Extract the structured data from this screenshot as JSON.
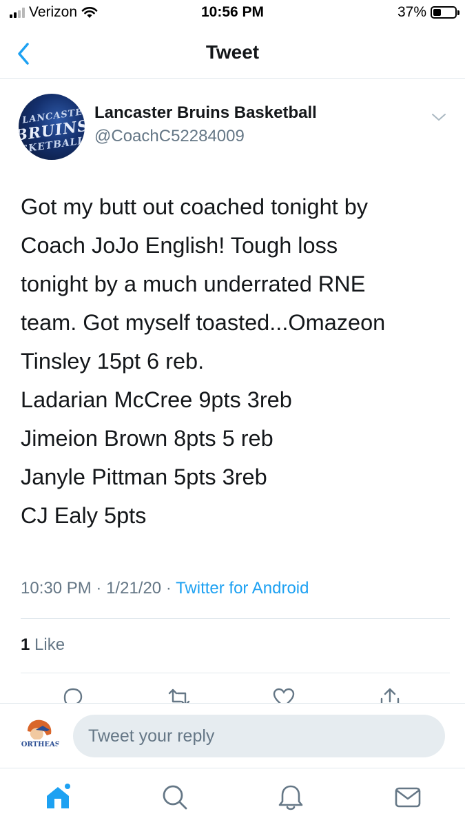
{
  "status_bar": {
    "carrier": "Verizon",
    "time": "10:56 PM",
    "battery": "37%",
    "icons": [
      "signal-icon",
      "wifi-icon",
      "battery-icon"
    ]
  },
  "nav": {
    "title": "Tweet",
    "back_icon": "chevron-left-icon"
  },
  "tweet": {
    "author_name": "Lancaster Bruins Basketball",
    "author_handle": "@CoachC52284009",
    "avatar_text": [
      "LANCASTER",
      "BRUINS",
      "SKETBALL"
    ],
    "lines": [
      "Got my butt out coached tonight by",
      "Coach JoJo English! Tough loss",
      "tonight by a much underrated RNE",
      "team. Got myself toasted...Omazeon",
      "Tinsley 15pt 6 reb.",
      "Ladarian McCree 9pts 3reb",
      "Jimeion Brown 8pts 5 reb",
      "Janyle Pittman 5pts 3reb",
      "CJ Ealy 5pts"
    ],
    "time": "10:30 PM",
    "date": "1/21/20",
    "separator": "·",
    "source": "Twitter for Android",
    "like_count": "1",
    "like_label": "Like"
  },
  "actions": [
    "reply-icon",
    "retweet-icon",
    "like-icon",
    "share-icon"
  ],
  "reply_bar": {
    "placeholder": "Tweet your reply",
    "avatar_text": "NORTHEAST"
  },
  "tabs": [
    "home-icon",
    "search-icon",
    "notifications-icon",
    "messages-icon"
  ],
  "colors": {
    "accent": "#1da1f2",
    "secondary_text": "#657786",
    "primary_text": "#14171a",
    "divider": "#e1e8ed",
    "input_bg": "#e6ecf0"
  }
}
